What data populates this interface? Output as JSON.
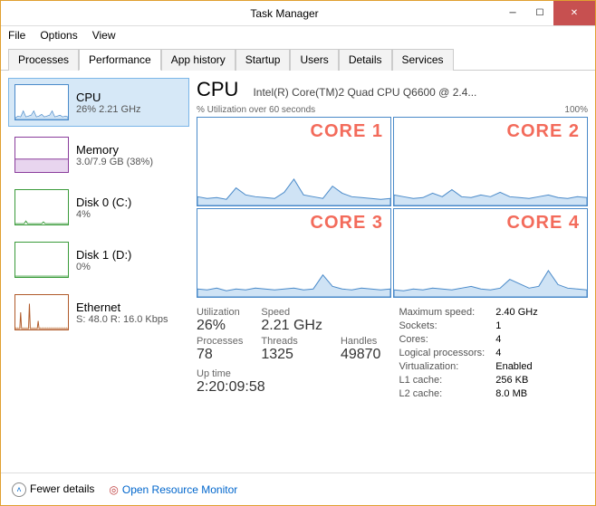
{
  "window": {
    "title": "Task Manager"
  },
  "menu": {
    "file": "File",
    "options": "Options",
    "view": "View"
  },
  "tabs": {
    "processes": "Processes",
    "performance": "Performance",
    "app_history": "App history",
    "startup": "Startup",
    "users": "Users",
    "details": "Details",
    "services": "Services"
  },
  "sidebar": {
    "cpu": {
      "title": "CPU",
      "sub": "26% 2.21 GHz"
    },
    "memory": {
      "title": "Memory",
      "sub": "3.0/7.9 GB (38%)"
    },
    "disk0": {
      "title": "Disk 0 (C:)",
      "sub": "4%"
    },
    "disk1": {
      "title": "Disk 1 (D:)",
      "sub": "0%"
    },
    "ethernet": {
      "title": "Ethernet",
      "sub": "S: 48.0 R: 16.0 Kbps"
    }
  },
  "main": {
    "title": "CPU",
    "model": "Intel(R) Core(TM)2 Quad CPU Q6600 @ 2.4...",
    "axis_left": "% Utilization over 60 seconds",
    "axis_right": "100%",
    "cores": [
      "CORE 1",
      "CORE 2",
      "CORE 3",
      "CORE 4"
    ]
  },
  "stats": {
    "utilization_label": "Utilization",
    "utilization": "26%",
    "speed_label": "Speed",
    "speed": "2.21 GHz",
    "processes_label": "Processes",
    "processes": "78",
    "threads_label": "Threads",
    "threads": "1325",
    "handles_label": "Handles",
    "handles": "49870",
    "uptime_label": "Up time",
    "uptime": "2:20:09:58"
  },
  "right_stats": {
    "max_speed_label": "Maximum speed:",
    "max_speed": "2.40 GHz",
    "sockets_label": "Sockets:",
    "sockets": "1",
    "cores_label": "Cores:",
    "cores": "4",
    "lp_label": "Logical processors:",
    "lp": "4",
    "virt_label": "Virtualization:",
    "virt": "Enabled",
    "l1_label": "L1 cache:",
    "l1": "256 KB",
    "l2_label": "L2 cache:",
    "l2": "8.0 MB"
  },
  "footer": {
    "fewer": "Fewer details",
    "resource_monitor": "Open Resource Monitor"
  },
  "chart_data": {
    "type": "area",
    "title": "CPU % Utilization over 60 seconds",
    "ylim": [
      0,
      100
    ],
    "xlabel": "seconds",
    "ylabel": "% Utilization",
    "series": [
      {
        "name": "CORE 1",
        "values": [
          10,
          8,
          9,
          7,
          20,
          12,
          10,
          9,
          8,
          15,
          30,
          12,
          10,
          8,
          22,
          14,
          10,
          9,
          8,
          7
        ]
      },
      {
        "name": "CORE 2",
        "values": [
          12,
          10,
          8,
          9,
          14,
          10,
          18,
          10,
          9,
          12,
          10,
          15,
          10,
          9,
          8,
          10,
          12,
          9,
          8,
          10
        ]
      },
      {
        "name": "CORE 3",
        "values": [
          9,
          8,
          10,
          7,
          9,
          8,
          10,
          9,
          8,
          9,
          10,
          8,
          9,
          25,
          12,
          9,
          8,
          10,
          9,
          8
        ]
      },
      {
        "name": "CORE 4",
        "values": [
          8,
          7,
          9,
          8,
          10,
          9,
          8,
          10,
          12,
          9,
          8,
          10,
          20,
          15,
          10,
          12,
          30,
          14,
          10,
          9
        ]
      }
    ]
  }
}
